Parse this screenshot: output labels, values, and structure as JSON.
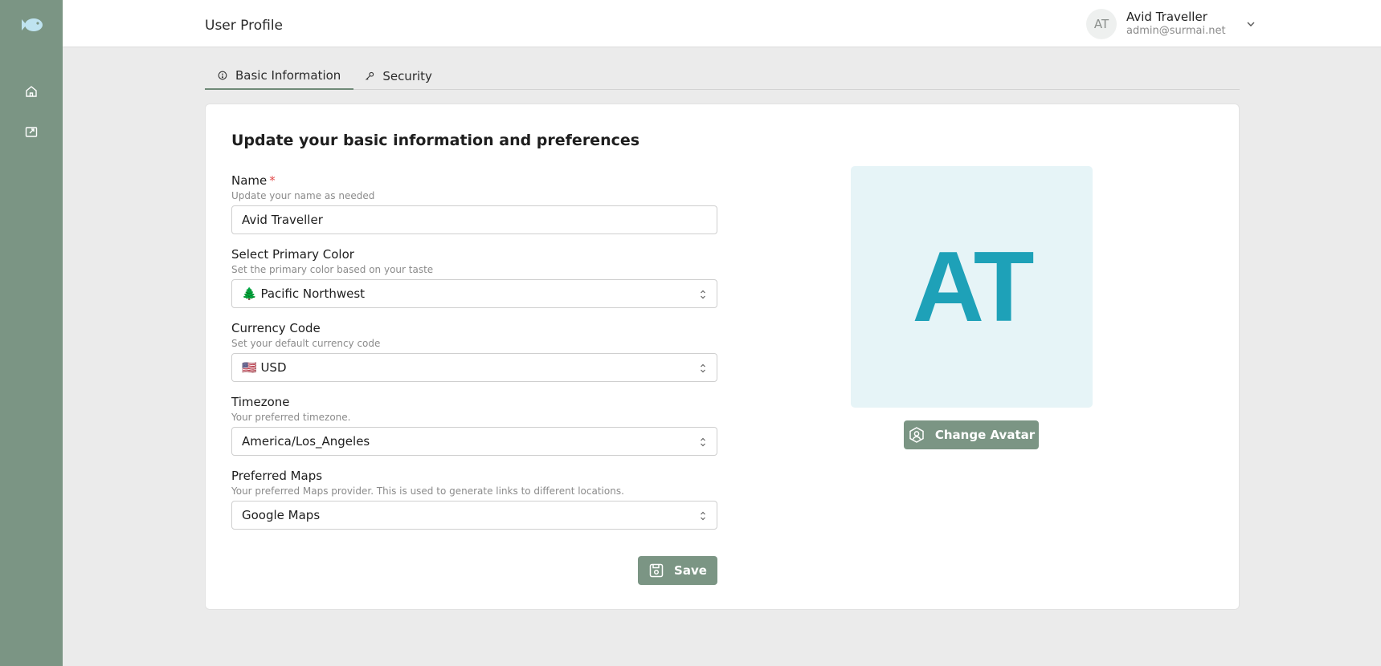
{
  "sidebar": {
    "logo_icon": "fish-icon",
    "items": [
      {
        "icon": "home-icon"
      },
      {
        "icon": "share-icon"
      }
    ]
  },
  "header": {
    "title": "User Profile",
    "user": {
      "initials": "AT",
      "name": "Avid Traveller",
      "email": "admin@surmai.net"
    }
  },
  "tabs": [
    {
      "label": "Basic Information",
      "icon": "info-icon",
      "active": true
    },
    {
      "label": "Security",
      "icon": "key-icon",
      "active": false
    }
  ],
  "form": {
    "heading": "Update your basic information and preferences",
    "name": {
      "label": "Name",
      "required_mark": "*",
      "description": "Update your name as needed",
      "value": "Avid Traveller"
    },
    "primary_color": {
      "label": "Select Primary Color",
      "description": "Set the primary color based on your taste",
      "value": "🌲 Pacific Northwest"
    },
    "currency": {
      "label": "Currency Code",
      "description": "Set your default currency code",
      "value": "🇺🇸 USD"
    },
    "timezone": {
      "label": "Timezone",
      "description": "Your preferred timezone.",
      "value": "America/Los_Angeles"
    },
    "maps": {
      "label": "Preferred Maps",
      "description": "Your preferred Maps provider. This is used to generate links to different locations.",
      "value": "Google Maps"
    },
    "save_label": "Save"
  },
  "avatar": {
    "initials": "AT",
    "change_label": "Change Avatar"
  },
  "colors": {
    "sidebar": "#7b9584",
    "accent": "#7b9584",
    "avatar_bg": "#e6f4f7",
    "avatar_text": "#1ea1b8",
    "required": "#e24a4a"
  }
}
